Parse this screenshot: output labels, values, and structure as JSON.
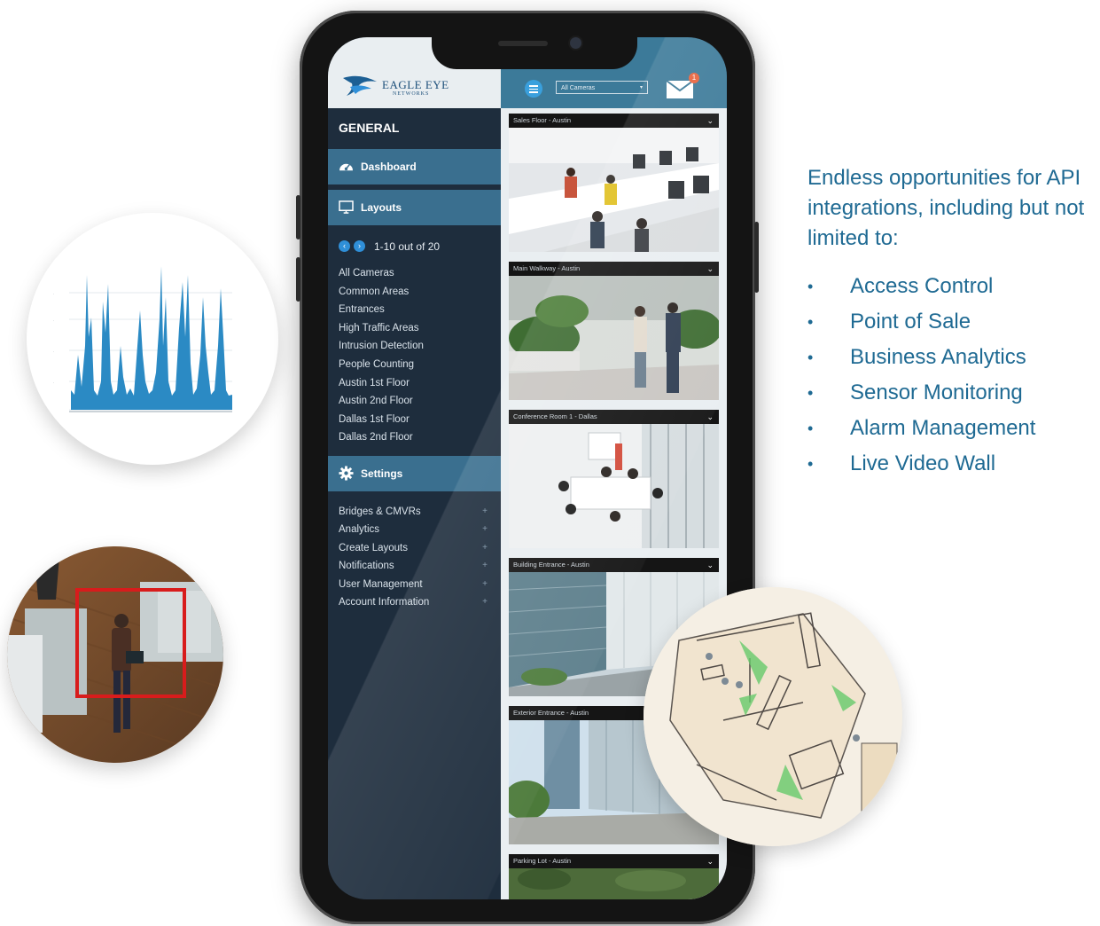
{
  "brand": {
    "logo_name": "EAGLE EYE",
    "logo_sub": "NETWORKS"
  },
  "sidebar": {
    "section_title": "GENERAL",
    "dashboard_label": "Dashboard",
    "layouts_label": "Layouts",
    "pager_text": "1-10 out of 20",
    "layouts": [
      "All Cameras",
      "Common Areas",
      "Entrances",
      "High Traffic Areas",
      "Intrusion Detection",
      "People Counting",
      "Austin 1st Floor",
      "Austin 2nd Floor",
      "Dallas 1st Floor",
      "Dallas 2nd Floor"
    ],
    "settings_label": "Settings",
    "settings_items": [
      "Bridges & CMVRs",
      "Analytics",
      "Create Layouts",
      "Notifications",
      "User Management",
      "Account Information"
    ],
    "plus_symbol": "+"
  },
  "topbar": {
    "camera_select_value": "All Cameras",
    "mail_badge": "1"
  },
  "cameras": [
    "Sales Floor - Austin",
    "Main Walkway - Austin",
    "Conference Room 1 - Dallas",
    "Building Entrance - Austin",
    "Exterior Entrance - Austin",
    "Parking Lot - Austin"
  ],
  "marketing": {
    "intro": "Endless opportunities for API integrations, including but not limited to:",
    "bullets": [
      "Access Control",
      "Point of Sale",
      "Business Analytics",
      "Sensor Monitoring",
      "Alarm Management",
      "Live Video Wall"
    ]
  },
  "colors": {
    "sidebar_bg": "#1e2d3d",
    "nav_button": "#3a6f8f",
    "topbar": "#3c7a99",
    "accent_blue": "#2f8fd8",
    "text_blue": "#1f6a93",
    "chart_blue": "#2b8ac4",
    "detection_box": "#d81c1c",
    "badge_orange": "#e8623c"
  }
}
